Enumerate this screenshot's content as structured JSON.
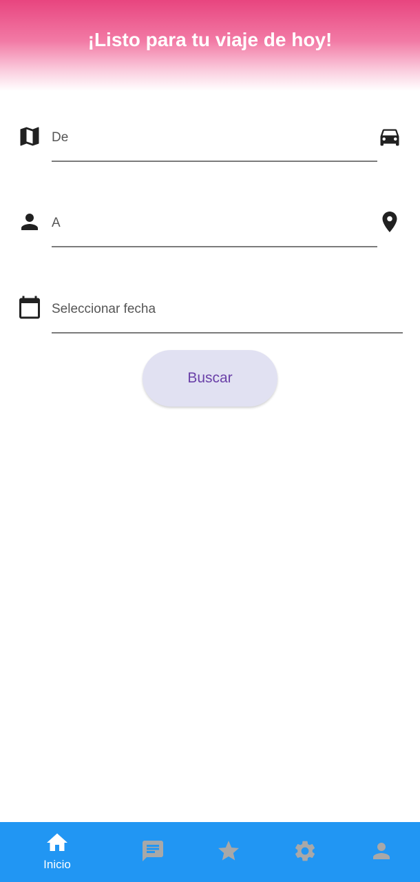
{
  "header": {
    "title": "¡Listo para tu viaje de hoy!",
    "gradient_top": "#e8457f",
    "gradient_bottom": "#ffffff"
  },
  "form": {
    "from_placeholder": "De",
    "to_placeholder": "A",
    "date_placeholder": "Seleccionar fecha",
    "search_label": "Buscar",
    "icons": {
      "from_leading": "map-icon",
      "from_trailing": "car-icon",
      "to_leading": "person-icon",
      "to_trailing": "location-pin-icon",
      "date_leading": "calendar-icon"
    }
  },
  "bottom_nav": {
    "background": "#2196f3",
    "active_index": 0,
    "items": [
      {
        "label": "Inicio",
        "icon": "home-icon",
        "active": true
      },
      {
        "icon": "chat-icon",
        "active": false
      },
      {
        "icon": "star-icon",
        "active": false
      },
      {
        "icon": "settings-icon",
        "active": false
      },
      {
        "icon": "profile-icon",
        "active": false
      }
    ]
  }
}
